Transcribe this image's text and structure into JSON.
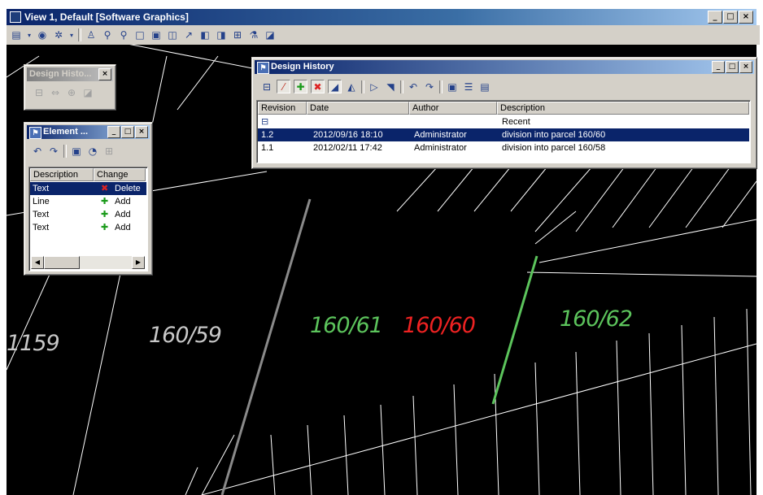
{
  "main_window": {
    "title": "View 1, Default [Software Graphics]",
    "buttons": {
      "minimize": "_",
      "maximize": "□",
      "close": "×"
    }
  },
  "view_toolbar": {
    "icons": [
      "view-attributes-icon",
      "level-display-icon",
      "display-style-icon",
      "update-view-icon",
      "zoom-in-icon",
      "zoom-out-icon",
      "window-area-icon",
      "fit-view-icon",
      "rotate-view-icon",
      "pan-view-icon",
      "view-previous-icon",
      "view-next-icon",
      "copy-view-icon",
      "clip-volume-icon",
      "camera-icon"
    ]
  },
  "design_history_toolbox": {
    "title": "Design Histo...",
    "close": "×"
  },
  "element_window": {
    "title": "Element ...",
    "columns": [
      "Description",
      "Change"
    ],
    "rows": [
      {
        "description": "Text",
        "change": "Delete",
        "change_type": "delete",
        "selected": true
      },
      {
        "description": "Line",
        "change": "Add",
        "change_type": "add",
        "selected": false
      },
      {
        "description": "Text",
        "change": "Add",
        "change_type": "add",
        "selected": false
      },
      {
        "description": "Text",
        "change": "Add",
        "change_type": "add",
        "selected": false
      }
    ],
    "glyphs": {
      "delete": "✖",
      "add": "✚"
    }
  },
  "design_history_window": {
    "title": "Design History",
    "columns": [
      "Revision",
      "Date",
      "Author",
      "Description"
    ],
    "rows": [
      {
        "revision": "",
        "date": "",
        "author": "",
        "description": "Recent",
        "selected": false,
        "has_icon": true
      },
      {
        "revision": "1.2",
        "date": "2012/09/16 18:10",
        "author": "Administrator",
        "description": "division into parcel 160/60",
        "selected": true,
        "has_icon": false
      },
      {
        "revision": "1.1",
        "date": "2012/02/11 17:42",
        "author": "Administrator",
        "description": "division into parcel 160/58",
        "selected": false,
        "has_icon": false
      }
    ]
  },
  "parcel_labels": [
    {
      "text": "1159",
      "color": "white"
    },
    {
      "text": "160/59",
      "color": "white"
    },
    {
      "text": "160/61",
      "color": "green"
    },
    {
      "text": "160/60",
      "color": "red"
    },
    {
      "text": "160/62",
      "color": "green"
    }
  ],
  "colors": {
    "canvas_background": "#000000",
    "parcel_line_white": "#ffffff",
    "parcel_line_gray": "#8a8a8a",
    "parcel_line_green": "#5cc45c",
    "label_red": "#ee2222",
    "selection": "#0a246a"
  }
}
